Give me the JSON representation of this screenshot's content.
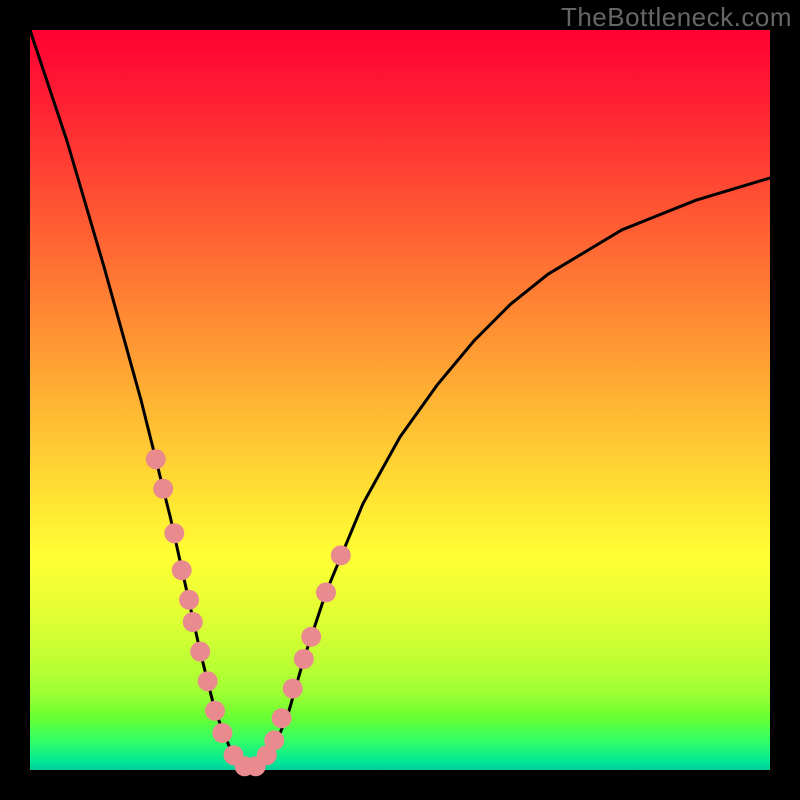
{
  "watermark": "TheBottleneck.com",
  "chart_data": {
    "type": "line",
    "title": "",
    "xlabel": "",
    "ylabel": "",
    "xlim": [
      0,
      100
    ],
    "ylim": [
      0,
      100
    ],
    "series": [
      {
        "name": "bottleneck-curve",
        "x": [
          0,
          5,
          10,
          15,
          17,
          19,
          21,
          23,
          25,
          27,
          29,
          31,
          33,
          35,
          37,
          40,
          45,
          50,
          55,
          60,
          65,
          70,
          75,
          80,
          85,
          90,
          95,
          100
        ],
        "y": [
          100,
          85,
          68,
          50,
          42,
          34,
          25,
          16,
          8,
          3,
          0,
          0,
          3,
          8,
          15,
          24,
          36,
          45,
          52,
          58,
          63,
          67,
          70,
          73,
          75,
          77,
          78.5,
          80
        ],
        "color": "#000000"
      }
    ],
    "markers": [
      {
        "x": 17,
        "y": 42
      },
      {
        "x": 18,
        "y": 38
      },
      {
        "x": 19.5,
        "y": 32
      },
      {
        "x": 20.5,
        "y": 27
      },
      {
        "x": 21.5,
        "y": 23
      },
      {
        "x": 22,
        "y": 20
      },
      {
        "x": 23,
        "y": 16
      },
      {
        "x": 24,
        "y": 12
      },
      {
        "x": 25,
        "y": 8
      },
      {
        "x": 26,
        "y": 5
      },
      {
        "x": 27.5,
        "y": 2
      },
      {
        "x": 29,
        "y": 0.5
      },
      {
        "x": 30.5,
        "y": 0.5
      },
      {
        "x": 32,
        "y": 2
      },
      {
        "x": 33,
        "y": 4
      },
      {
        "x": 34,
        "y": 7
      },
      {
        "x": 35.5,
        "y": 11
      },
      {
        "x": 37,
        "y": 15
      },
      {
        "x": 38,
        "y": 18
      },
      {
        "x": 40,
        "y": 24
      },
      {
        "x": 42,
        "y": 29
      }
    ],
    "marker_color": "#e98a8f",
    "marker_radius_px": 10,
    "background_gradient": {
      "type": "linear-vertical",
      "stops": [
        {
          "pos": 0.0,
          "color": "#ff0033"
        },
        {
          "pos": 0.5,
          "color": "#ffcc33"
        },
        {
          "pos": 0.78,
          "color": "#ccff33"
        },
        {
          "pos": 0.93,
          "color": "#66ff33"
        },
        {
          "pos": 1.0,
          "color": "#00cc99"
        }
      ]
    }
  }
}
